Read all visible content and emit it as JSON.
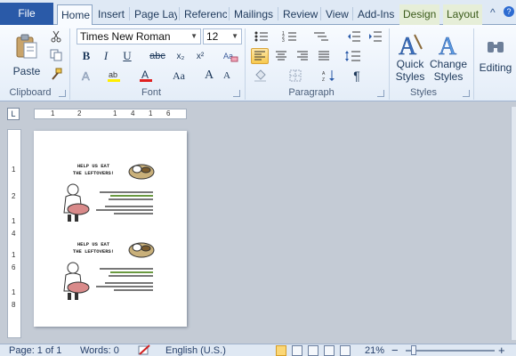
{
  "tabs": {
    "file": "File",
    "items": [
      "Home",
      "Insert",
      "Page Lay",
      "Referenc",
      "Mailings",
      "Review",
      "View",
      "Add-Ins",
      "Design",
      "Layout"
    ],
    "active": "Home"
  },
  "window_controls": {
    "caret": "^",
    "help": "?"
  },
  "clipboard": {
    "paste": "Paste",
    "label": "Clipboard"
  },
  "font": {
    "name": "Times New Roman",
    "size": "12",
    "bold": "B",
    "italic": "I",
    "underline": "U",
    "strike": "abc",
    "subscript": "x₂",
    "superscript": "x²",
    "change_case": "Aa",
    "grow": "A",
    "shrink": "A",
    "label": "Font"
  },
  "paragraph": {
    "label": "Paragraph",
    "pilcrow": "¶"
  },
  "styles": {
    "quick": "Quick",
    "quick2": "Styles",
    "change": "Change",
    "change2": "Styles",
    "label": "Styles"
  },
  "editing": {
    "label": "Editing"
  },
  "ruler": {
    "marks": [
      "1",
      "2",
      "1",
      "4",
      "1",
      "6"
    ],
    "vmarks": [
      "1",
      "2",
      "1",
      "4",
      "1",
      "6",
      "1",
      "8"
    ]
  },
  "document": {
    "flyer1": {
      "line1": "HELP US EAT",
      "line2": "THE LEFTOVERS!"
    },
    "flyer2": {
      "line1": "HELP US EAT",
      "line2": "THE LEFTOVERS!"
    }
  },
  "status": {
    "page": "Page: 1 of 1",
    "words": "Words: 0",
    "language": "English (U.S.)",
    "zoom": "21%",
    "zoom_minus": "−",
    "zoom_plus": "+"
  },
  "colors": {
    "file_tab": "#2a5aa8",
    "ribbon_bg": "#e4edf8",
    "selected": "#f7c94f"
  }
}
